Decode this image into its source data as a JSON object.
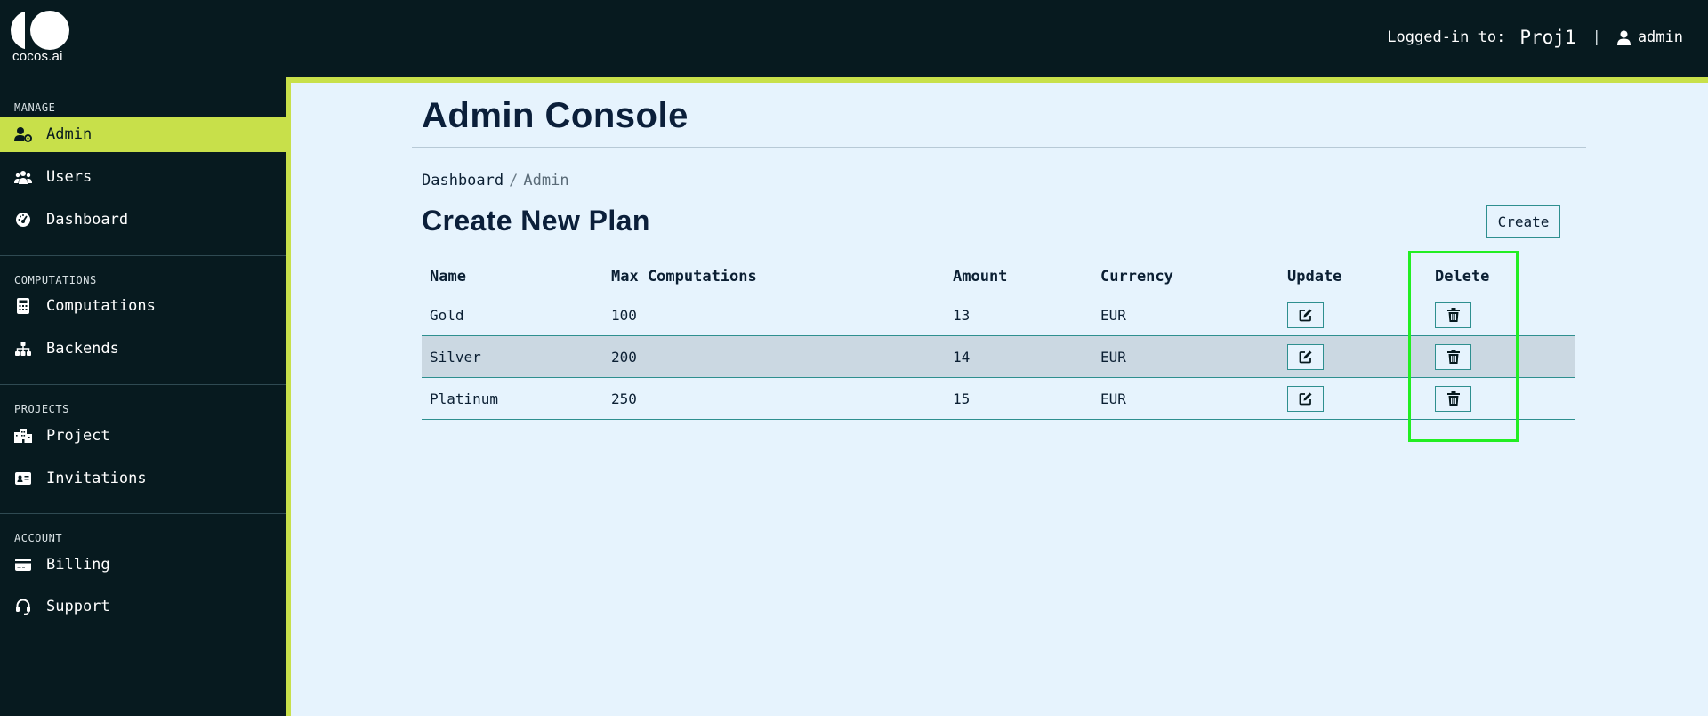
{
  "header": {
    "logo_text": "cocos.ai",
    "logged_in_label": "Logged-in to:",
    "project": "Proj1",
    "separator": "|",
    "username": "admin"
  },
  "sidebar": {
    "sections": [
      {
        "title": "MANAGE",
        "items": [
          {
            "label": "Admin",
            "icon": "user-gear-icon",
            "active": true
          },
          {
            "label": "Users",
            "icon": "users-icon"
          },
          {
            "label": "Dashboard",
            "icon": "gauge-icon"
          }
        ]
      },
      {
        "title": "COMPUTATIONS",
        "items": [
          {
            "label": "Computations",
            "icon": "calculator-icon"
          },
          {
            "label": "Backends",
            "icon": "sitemap-icon"
          }
        ]
      },
      {
        "title": "PROJECTS",
        "items": [
          {
            "label": "Project",
            "icon": "building-icon"
          },
          {
            "label": "Invitations",
            "icon": "id-card-icon"
          }
        ]
      },
      {
        "title": "ACCOUNT",
        "items": [
          {
            "label": "Billing",
            "icon": "credit-card-icon"
          },
          {
            "label": "Support",
            "icon": "headset-icon"
          }
        ]
      }
    ]
  },
  "main": {
    "title": "Admin Console",
    "breadcrumb": {
      "link": "Dashboard",
      "separator": "/",
      "current": "Admin"
    },
    "section_heading": "Create New Plan",
    "create_label": "Create",
    "table": {
      "headers": [
        "Name",
        "Max Computations",
        "Amount",
        "Currency",
        "Update",
        "Delete"
      ],
      "rows": [
        {
          "name": "Gold",
          "max": "100",
          "amount": "13",
          "currency": "EUR"
        },
        {
          "name": "Silver",
          "max": "200",
          "amount": "14",
          "currency": "EUR"
        },
        {
          "name": "Platinum",
          "max": "250",
          "amount": "15",
          "currency": "EUR"
        }
      ]
    }
  },
  "colors": {
    "sidebar_bg": "#071a1f",
    "accent": "#c8e04a",
    "content_bg": "#e6f3fd",
    "table_border": "#2e8f8f",
    "alt_row": "#cbd8e2",
    "highlight": "#22ee22"
  }
}
